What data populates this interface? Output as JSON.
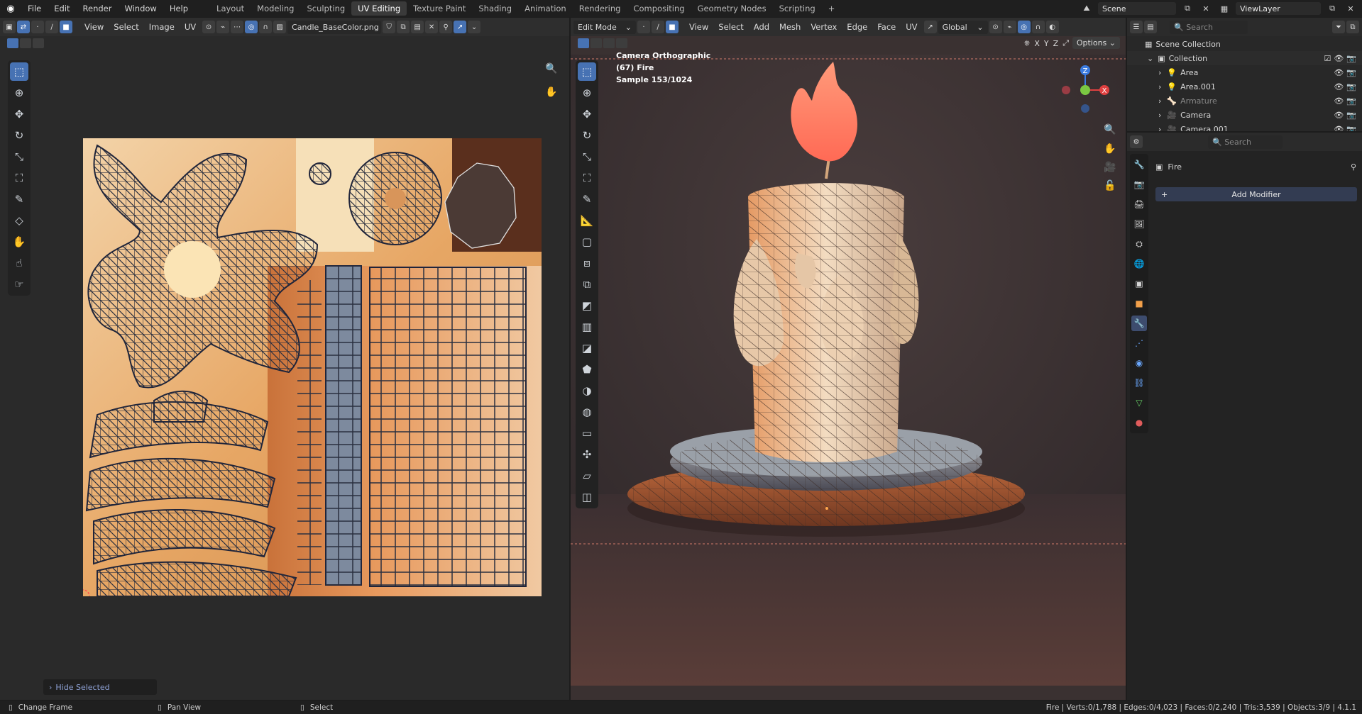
{
  "topbar": {
    "menus": [
      "File",
      "Edit",
      "Render",
      "Window",
      "Help"
    ],
    "workspaces": [
      "Layout",
      "Modeling",
      "Sculpting",
      "UV Editing",
      "Texture Paint",
      "Shading",
      "Animation",
      "Rendering",
      "Compositing",
      "Geometry Nodes",
      "Scripting"
    ],
    "active_workspace": "UV Editing",
    "add_tab": "+",
    "scene": "Scene",
    "view_layer": "ViewLayer"
  },
  "uv_editor": {
    "menus": [
      "View",
      "Select",
      "Image",
      "UV"
    ],
    "image_name": "Candle_BaseColor.png",
    "hide_selected": "Hide Selected"
  },
  "viewport": {
    "mode": "Edit Mode",
    "menus": [
      "View",
      "Select",
      "Add",
      "Mesh",
      "Vertex",
      "Edge",
      "Face",
      "UV"
    ],
    "orientation": "Global",
    "axes": [
      "X",
      "Y",
      "Z"
    ],
    "options": "Options",
    "overlay_lines": [
      "Camera Orthographic",
      "(67) Fire",
      "Sample 153/1024"
    ],
    "gizmo": {
      "x": "X",
      "z": "Z"
    }
  },
  "outliner": {
    "search_placeholder": "Search",
    "scene_collection": "Scene Collection",
    "collection": "Collection",
    "items": [
      "Area",
      "Area.001",
      "Armature",
      "Camera",
      "Camera.001"
    ]
  },
  "properties": {
    "search_placeholder": "Search",
    "object_name": "Fire",
    "add_modifier": "Add Modifier"
  },
  "status": {
    "change_frame": "Change Frame",
    "pan_view": "Pan View",
    "select": "Select",
    "stats": "Fire | Verts:0/1,788 | Edges:0/4,023 | Faces:0/2,240 | Tris:3,539 | Objects:3/9 | 4.1.1"
  },
  "colors": {
    "accent": "#4772b3",
    "panel": "#2b2b2b",
    "header": "#2e2e2e",
    "flame": "#ff7a59",
    "wax": "#e8c9a8"
  }
}
